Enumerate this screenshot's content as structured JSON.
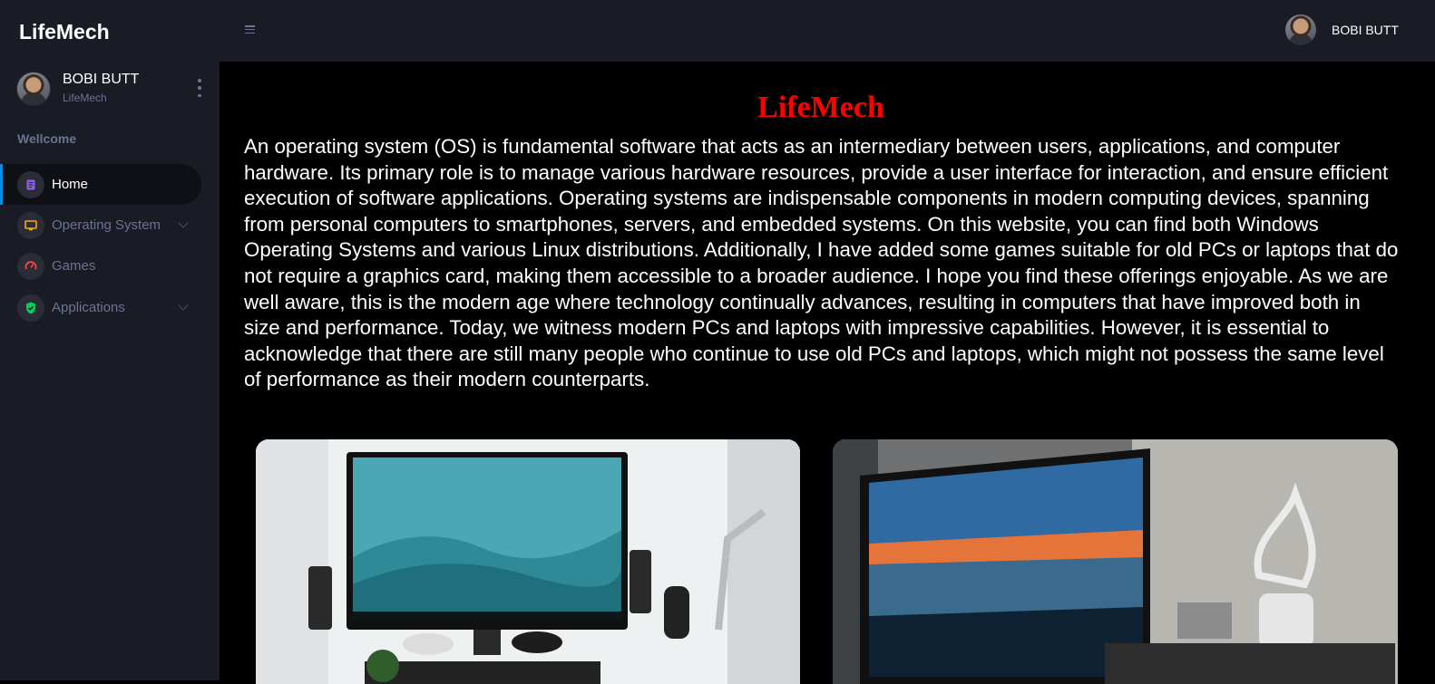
{
  "sidebar": {
    "brand": "LifeMech",
    "profile": {
      "name": "BOBI BUTT",
      "subtitle": "LifeMech"
    },
    "section_label": "Wellcome",
    "items": [
      {
        "label": "Home",
        "icon": "document-icon",
        "color": "#8f5fe8",
        "active": true
      },
      {
        "label": "Operating System",
        "icon": "laptop-icon",
        "color": "#ffab00",
        "has_submenu": true
      },
      {
        "label": "Games",
        "icon": "speedometer-icon",
        "color": "#fc424a"
      },
      {
        "label": "Applications",
        "icon": "shield-icon",
        "color": "#00d25b",
        "has_submenu": true
      }
    ]
  },
  "topbar": {
    "user_name": "BOBI BUTT"
  },
  "main": {
    "title": "LifeMech",
    "intro": "An operating system (OS) is fundamental software that acts as an intermediary between users, applications, and computer hardware. Its primary role is to manage various hardware resources, provide a user interface for interaction, and ensure efficient execution of software applications. Operating systems are indispensable components in modern computing devices, spanning from personal computers to smartphones, servers, and embedded systems. On this website, you can find both Windows Operating Systems and various Linux distributions. Additionally, I have added some games suitable for old PCs or laptops that do not require a graphics card, making them accessible to a broader audience. I hope you find these offerings enjoyable. As we are well aware, this is the modern age where technology continually advances, resulting in computers that have improved both in size and performance. Today, we witness modern PCs and laptops with impressive capabilities. However, it is essential to acknowledge that there are still many people who continue to use old PCs and laptops, which might not possess the same level of performance as their modern counterparts."
  },
  "colors": {
    "accent_title": "#ff0000",
    "active_indicator": "#0090e7",
    "sidebar_bg": "#191c24"
  }
}
